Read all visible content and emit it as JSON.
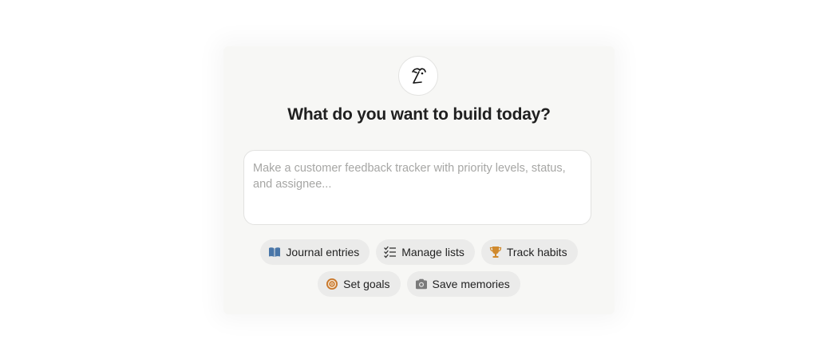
{
  "heading": "What do you want to build today?",
  "prompt": {
    "placeholder": "Make a customer feedback tracker with priority levels, status, and assignee..."
  },
  "suggestions": [
    {
      "label": "Journal entries",
      "icon": "book-icon"
    },
    {
      "label": "Manage lists",
      "icon": "checklist-icon"
    },
    {
      "label": "Track habits",
      "icon": "trophy-icon"
    },
    {
      "label": "Set goals",
      "icon": "target-icon"
    },
    {
      "label": "Save memories",
      "icon": "camera-icon"
    }
  ],
  "colors": {
    "book": "#4a76a8",
    "trophy": "#d08a2e",
    "target": "#c9772a",
    "camera": "#7a7a7a"
  }
}
